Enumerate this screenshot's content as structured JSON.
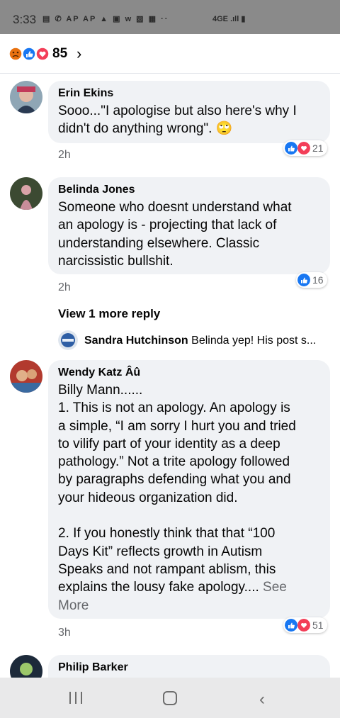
{
  "status_bar": {
    "time": "3:33",
    "icons": [
      "messenger-icon",
      "missed-call-icon",
      "ap-news-icon",
      "ap-news-icon",
      "gallery-icon",
      "news-icon",
      "w-icon",
      "image-icon",
      "calendar-icon",
      "more-dots-icon"
    ],
    "icons_text": "▤ ✆ AP AP ▲ ▣ w ▧ ▦ ··",
    "network": "4G",
    "right_text": "4GE .ıll ▮"
  },
  "reactions_header": {
    "count": "85",
    "emojis": [
      "angry",
      "like",
      "love"
    ]
  },
  "comments": [
    {
      "author": "Erin Ekins",
      "lines": [
        "Sooo...\"I apologise but also here's why I",
        "didn't do anything wrong\". 🙄"
      ],
      "time": "2h",
      "reaction_count": "21",
      "reactions": [
        "like",
        "love"
      ]
    },
    {
      "author": "Belinda Jones",
      "lines": [
        "Someone who doesnt understand what",
        "an apology is - projecting that lack of",
        "understanding elsewhere.  Classic",
        "narcissistic bullshit."
      ],
      "time": "2h",
      "reaction_count": "16",
      "reactions": [
        "like"
      ],
      "view_more": "View 1 more reply",
      "reply_preview": {
        "author": "Sandra Hutchinson",
        "text": "Belinda yep! His post s..."
      }
    },
    {
      "author": "Wendy Katz Âû",
      "lines": [
        "Billy Mann......",
        "1. This is not an apology.  An apology is",
        "a simple, “I am sorry I hurt you and tried",
        "to vilify part of your identity as a deep",
        "pathology.”  Not a trite apology followed",
        "by paragraphs defending what you and",
        "your hideous organization did.",
        "",
        "2. If you honestly think that that “100",
        "Days Kit” reflects growth in Autism",
        "Speaks and not rampant ablism, this"
      ],
      "last_line": "explains the lousy fake apology.... ",
      "see_more": "See More",
      "see_more_first": "See",
      "see_more_second": "More",
      "time": "3h",
      "reaction_count": "51",
      "reactions": [
        "like",
        "love"
      ]
    },
    {
      "author": "Philip Barker"
    }
  ],
  "colors": {
    "bubble": "#f0f2f5",
    "like": "#1877f2",
    "love": "#f33e58",
    "angry": "#e9710f",
    "secondary_text": "#65676b"
  }
}
